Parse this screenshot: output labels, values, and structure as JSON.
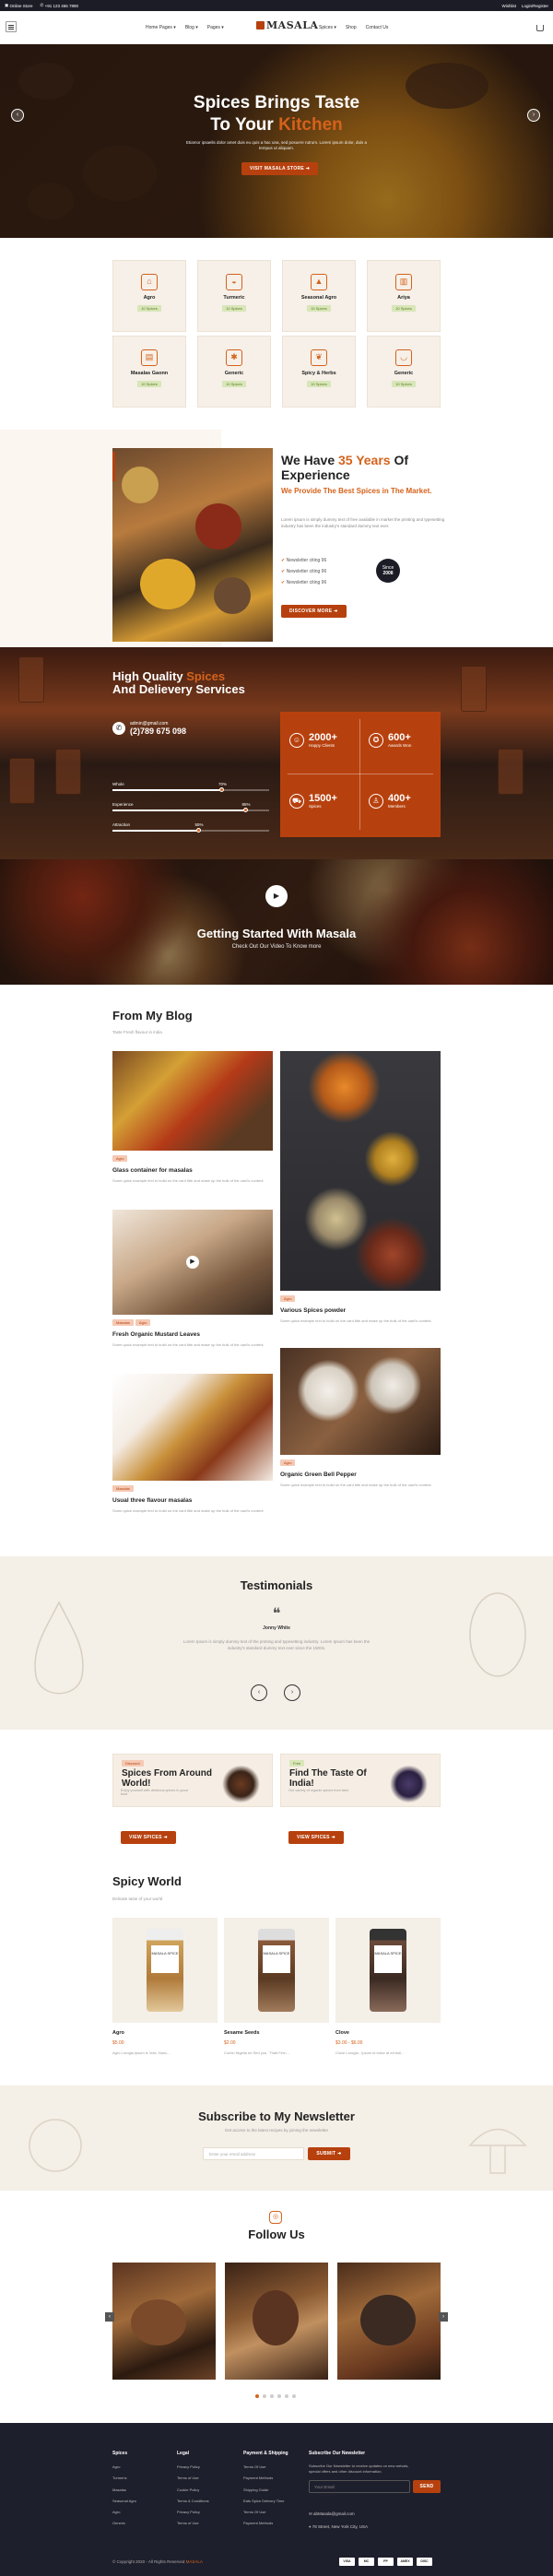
{
  "topbar": {
    "left_text": "Online Store",
    "phone": "+91 123 456 7890",
    "right_links": [
      "Wishlist",
      "Login/Register"
    ]
  },
  "header": {
    "nav": [
      "Home Pages",
      "Blog",
      "Pages",
      "Spices",
      "Shop",
      "Contact Us"
    ],
    "logo": "MASALA"
  },
  "hero": {
    "title_line1": "Spices Brings Taste",
    "title_line2": "To Your",
    "title_accent": "Kitchen",
    "desc": "Etiamor ipsaelis dolor amet duis eu quis a hac una, sed posuere rutrum. Lorem ipsum dolor, duis a tempus ut aliquam.",
    "button": "VISIT MASALA STORE"
  },
  "categories": [
    {
      "name": "Agro",
      "count": "10 Spices",
      "icon": "bag-icon"
    },
    {
      "name": "Turmeric",
      "count": "10 Spices",
      "icon": "mortar-icon"
    },
    {
      "name": "Seasonal Agro",
      "count": "10 Spices",
      "icon": "cone-icon"
    },
    {
      "name": "Ariya",
      "count": "10 Spices",
      "icon": "jar-icon"
    },
    {
      "name": "Masalas Gaonn",
      "count": "10 Spices",
      "icon": "box-icon"
    },
    {
      "name": "Generic",
      "count": "10 Spices",
      "icon": "star-anise-icon"
    },
    {
      "name": "Spicy & Herbs",
      "count": "10 Spices",
      "icon": "pepper-icon"
    },
    {
      "name": "Generic",
      "count": "10 Spices",
      "icon": "bowl-icon"
    }
  ],
  "about": {
    "heading_pre": "We Have",
    "heading_accent": "35 Years",
    "heading_post": "Of Experience",
    "subheading": "We Provide The Best Spices in The Market.",
    "desc": "Lorem ipsum is simply dummy text of free available in market the printing and typesetting industry has been the industry's standard dummy text ever.",
    "list": [
      "Newsletter citing 96",
      "Newsletter citing 96",
      "Newsletter citing 96"
    ],
    "since_label": "Since",
    "since_year": "2008",
    "button": "DISCOVER MORE"
  },
  "features": {
    "heading_pre": "High Quality",
    "heading_accent": "Spices",
    "heading_post": "And Delievery Services",
    "email": "admin@gmail.com",
    "phone": "(2)789 675 098",
    "progress": [
      {
        "label": "Whole",
        "value": 70,
        "display": "70%"
      },
      {
        "label": "Experience",
        "value": 85,
        "display": "85%"
      },
      {
        "label": "Attraction",
        "value": 55,
        "display": "55%"
      }
    ],
    "stats": [
      {
        "value": "2000+",
        "label": "Happy Clients",
        "icon": "group-icon"
      },
      {
        "value": "600+",
        "label": "Awards Won",
        "icon": "award-icon"
      },
      {
        "value": "1500+",
        "label": "Spices",
        "icon": "truck-icon"
      },
      {
        "value": "400+",
        "label": "Members",
        "icon": "person-icon"
      }
    ]
  },
  "video": {
    "title": "Getting Started With Masala",
    "subtitle": "Check Out Our Video To Know more"
  },
  "blog": {
    "heading": "From My Blog",
    "subheading": "Taste Fresh flavour in india",
    "posts": [
      {
        "title": "Glass container for masalas",
        "tags": [
          "Agro"
        ],
        "desc": "Some quick example text to build on the card title and make up the bulk of the card's content."
      },
      {
        "title": "Various Spices powder",
        "tags": [
          "Agro"
        ],
        "desc": "Some quick example text to build on the card title and make up the bulk of the card's content."
      },
      {
        "title": "Fresh Organic Mustard Leaves",
        "tags": [
          "Masalas",
          "Agro"
        ],
        "desc": "Some quick example text to build on the card title and make up the bulk of the card's content."
      },
      {
        "title": "Organic Green Bell Pepper",
        "tags": [
          "Agro"
        ],
        "desc": "Some quick example text to build on the card title and make up the bulk of the card's content."
      },
      {
        "title": "Usual three flavour masalas",
        "tags": [
          "Masalas"
        ],
        "desc": "Some quick example text to build on the card title and make up the bulk of the card's content."
      }
    ]
  },
  "testimonials": {
    "heading": "Testimonials",
    "name": "Jonny White",
    "text": "Lorem Ipsum is simply dummy text of the printing and typesetting industry. Lorem Ipsum has been the industry's standard dummy text ever since the 1500s."
  },
  "offers": [
    {
      "tag": "Discount",
      "title": "Spices From Around World!",
      "desc": "Enjoy yourself with delicious spices in good food",
      "button": "VIEW SPICES"
    },
    {
      "tag": "Free",
      "title": "Find The Taste Of India!",
      "desc": "Our variety of organic spices from farm",
      "button": "VIEW SPICES"
    }
  ],
  "products": {
    "heading": "Spicy World",
    "subheading": "Delicate taste of your world",
    "items": [
      {
        "name": "Agro",
        "price": "$5.00",
        "desc": "Agro Lorogia ipsum is 'less, Nunc...",
        "label": "MASALA SPICE"
      },
      {
        "name": "Sesame Seeds",
        "price": "$2.00",
        "desc": "Cumin Nigella ed Sed you, 'Thalt Fern...",
        "label": "MASALA SPICE"
      },
      {
        "name": "Clove",
        "price": "$3.00 - $6.00",
        "desc": "Clove Lorogia - Ipsum id tortor at ed bull...",
        "label": "MASALA SPICE"
      }
    ]
  },
  "newsletter": {
    "heading": "Subscribe to My Newsletter",
    "subheading": "Get access to the latest recipes by joining the newsletter",
    "placeholder": "Enter your email address",
    "button": "SUBMIT"
  },
  "follow": {
    "heading": "Follow Us"
  },
  "footer": {
    "columns": [
      {
        "heading": "Spices",
        "links": [
          "Agro",
          "Turmeric",
          "Masalas",
          "Seasonal Agro",
          "Agro",
          "Generic"
        ]
      },
      {
        "heading": "Legal",
        "links": [
          "Privacy Policy",
          "Terms of Use",
          "Cookie Policy",
          "Terms & Conditions",
          "Privacy Policy",
          "Terms of Use"
        ]
      },
      {
        "heading": "Payment & Shipping",
        "links": [
          "Terms Of Use",
          "Payment Methods",
          "Shipping Guide",
          "Eats Spice Delivery Time",
          "Terms Of Use",
          "Payment Methods"
        ]
      }
    ],
    "newsletter_heading": "Subscribe Our Newsletter",
    "newsletter_desc": "Subscribe Our Newsletter to receive updates on new arrivals, special offers and other discount information.",
    "email_placeholder": "Your Email",
    "send_button": "SEND",
    "contact_email": "abMasala@gmail.com",
    "address": "78 Street, New York City, USA",
    "copyright_pre": "© Copyright 2020 - All Rights Reserved",
    "copyright_brand": "MASALA",
    "payments": [
      "VISA",
      "MC",
      "PP",
      "AMEX",
      "DISC"
    ]
  }
}
